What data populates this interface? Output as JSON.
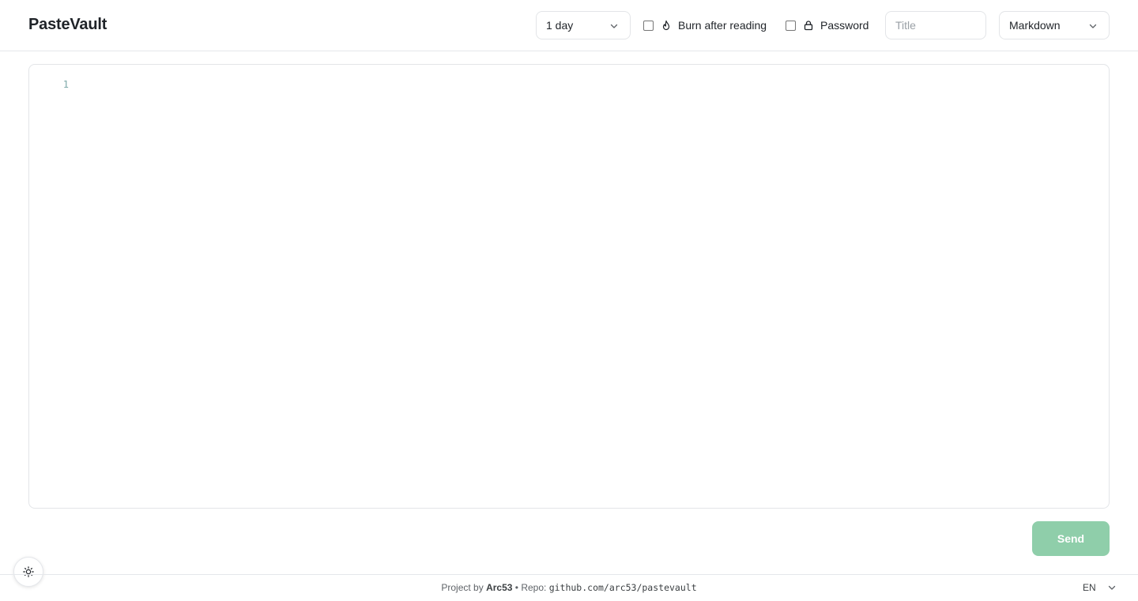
{
  "app": {
    "name": "PasteVault"
  },
  "toolbar": {
    "expiry": {
      "selected": "1 day"
    },
    "burn_after_reading": {
      "label": "Burn after reading",
      "checked": false,
      "icon": "flame-icon"
    },
    "password": {
      "label": "Password",
      "checked": false,
      "icon": "lock-icon"
    },
    "title_input": {
      "value": "",
      "placeholder": "Title"
    },
    "format": {
      "selected": "Markdown"
    }
  },
  "editor": {
    "line_numbers": [
      "1"
    ],
    "content": ""
  },
  "actions": {
    "send_label": "Send"
  },
  "footer": {
    "project_prefix": "Project by",
    "author": "Arc53",
    "separator": "•",
    "repo_prefix": "Repo:",
    "repo": "github.com/arc53/pastevault",
    "language": "EN"
  },
  "theme_toggle": {
    "icon": "sun-icon"
  },
  "colors": {
    "send_button": "#8fceaa",
    "line_number": "#7ea9a9",
    "border": "#e3e5e8"
  }
}
